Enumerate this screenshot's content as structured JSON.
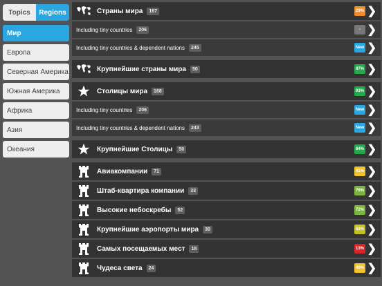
{
  "segments": {
    "topics": "Topics",
    "regions": "Regions"
  },
  "regions": [
    "Мир",
    "Европа",
    "Северная Америка",
    "Южная Америка",
    "Африка",
    "Азия",
    "Океания"
  ],
  "colors": {
    "accent": "#2aa7e0",
    "orange": "#f28c28",
    "green": "#23a84b",
    "olive": "#7bb53a",
    "yellow": "#f2c12e",
    "red": "#d9252a",
    "gray": "#777777",
    "blue": "#2aa7e0"
  },
  "rows": [
    {
      "type": "main",
      "icon": "world-map-icon",
      "label": "Страны мира",
      "count": "167",
      "badge": "29%",
      "badge_color": "#f28c28"
    },
    {
      "type": "sub",
      "label": "Including tiny countries",
      "count": "206",
      "badge": "-",
      "badge_color": "#777777"
    },
    {
      "type": "sub",
      "label": "Including tiny countries & dependent nations",
      "count": "245",
      "badge": "New",
      "badge_color": "#2aa7e0"
    },
    {
      "type": "main",
      "icon": "world-map-icon",
      "label": "Крупнейшие страны мира",
      "count": "50",
      "badge": "87%",
      "badge_color": "#23a84b"
    },
    {
      "type": "main",
      "icon": "star-icon",
      "label": "Столицы мира",
      "count": "168",
      "badge": "93%",
      "badge_color": "#23a84b"
    },
    {
      "type": "sub",
      "label": "Including tiny countries",
      "count": "206",
      "badge": "New",
      "badge_color": "#2aa7e0"
    },
    {
      "type": "sub",
      "label": "Including tiny countries & dependent nations",
      "count": "243",
      "badge": "New",
      "badge_color": "#2aa7e0"
    },
    {
      "type": "main",
      "icon": "star-icon",
      "label": "Крупнейшие Столицы",
      "count": "50",
      "badge": "84%",
      "badge_color": "#23a84b"
    },
    {
      "type": "main",
      "icon": "castle-icon",
      "label": "Авиакомпании",
      "count": "71",
      "badge": "41%",
      "badge_color": "#f2c12e"
    },
    {
      "type": "main",
      "icon": "castle-icon",
      "label": "Штаб-квартира компании",
      "count": "33",
      "badge": "76%",
      "badge_color": "#7bb53a"
    },
    {
      "type": "main",
      "icon": "castle-icon",
      "label": "Высокие небоскребы",
      "count": "52",
      "badge": "72%",
      "badge_color": "#7bb53a"
    },
    {
      "type": "main",
      "icon": "castle-icon",
      "label": "Крупнейшие аэропорты мира",
      "count": "30",
      "badge": "53%",
      "badge_color": "#c7c221"
    },
    {
      "type": "main",
      "icon": "castle-icon",
      "label": "Самых посещаемых мест",
      "count": "18",
      "badge": "13%",
      "badge_color": "#d9252a"
    },
    {
      "type": "main",
      "icon": "castle-icon",
      "label": "Чудеса света",
      "count": "24",
      "badge": "40%",
      "badge_color": "#f2c12e"
    }
  ]
}
